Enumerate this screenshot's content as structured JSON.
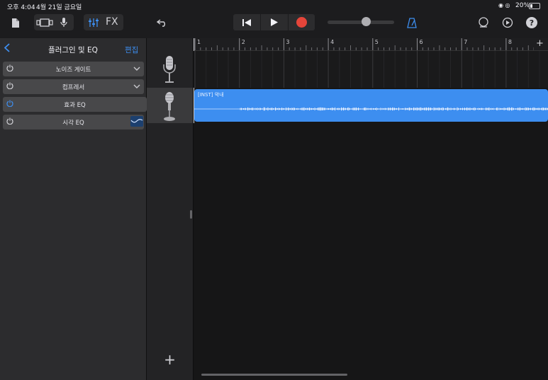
{
  "status_bar": {
    "time": "오후 4:04",
    "date": "4월 21일 금요일",
    "battery": "20%"
  },
  "toolbar": {
    "fx_label": "FX",
    "icons": {
      "document": "document-icon",
      "views": "track-view-icon",
      "mic": "microphone-icon",
      "mixer": "mixer-icon",
      "undo": "undo-icon",
      "rewind": "go-to-start-icon",
      "play": "play-icon",
      "record": "record-icon",
      "metronome": "metronome-icon",
      "loop": "loop-browser-icon",
      "settings": "settings-icon",
      "help": "help-icon"
    },
    "record_color": "#e5453a",
    "accent_color": "#3d8ef0",
    "master_volume": 0.6
  },
  "panel": {
    "title": "플러그인 및 EQ",
    "back_label": "<",
    "edit_label": "편집",
    "plugins": [
      {
        "name": "노이즈 게이트",
        "on": false,
        "has_chevron": true
      },
      {
        "name": "컴프레서",
        "on": false,
        "has_chevron": true
      },
      {
        "name": "효과 EQ",
        "on": true,
        "has_chevron": false
      },
      {
        "name": "시각 EQ",
        "on": false,
        "has_chevron": false
      }
    ]
  },
  "timeline": {
    "ruler_numbers": [
      "1",
      "2",
      "3",
      "4",
      "5",
      "6",
      "7",
      "8"
    ],
    "region_label": "[INST] 악내",
    "add_track_label": "+",
    "add_section_label": "+"
  }
}
